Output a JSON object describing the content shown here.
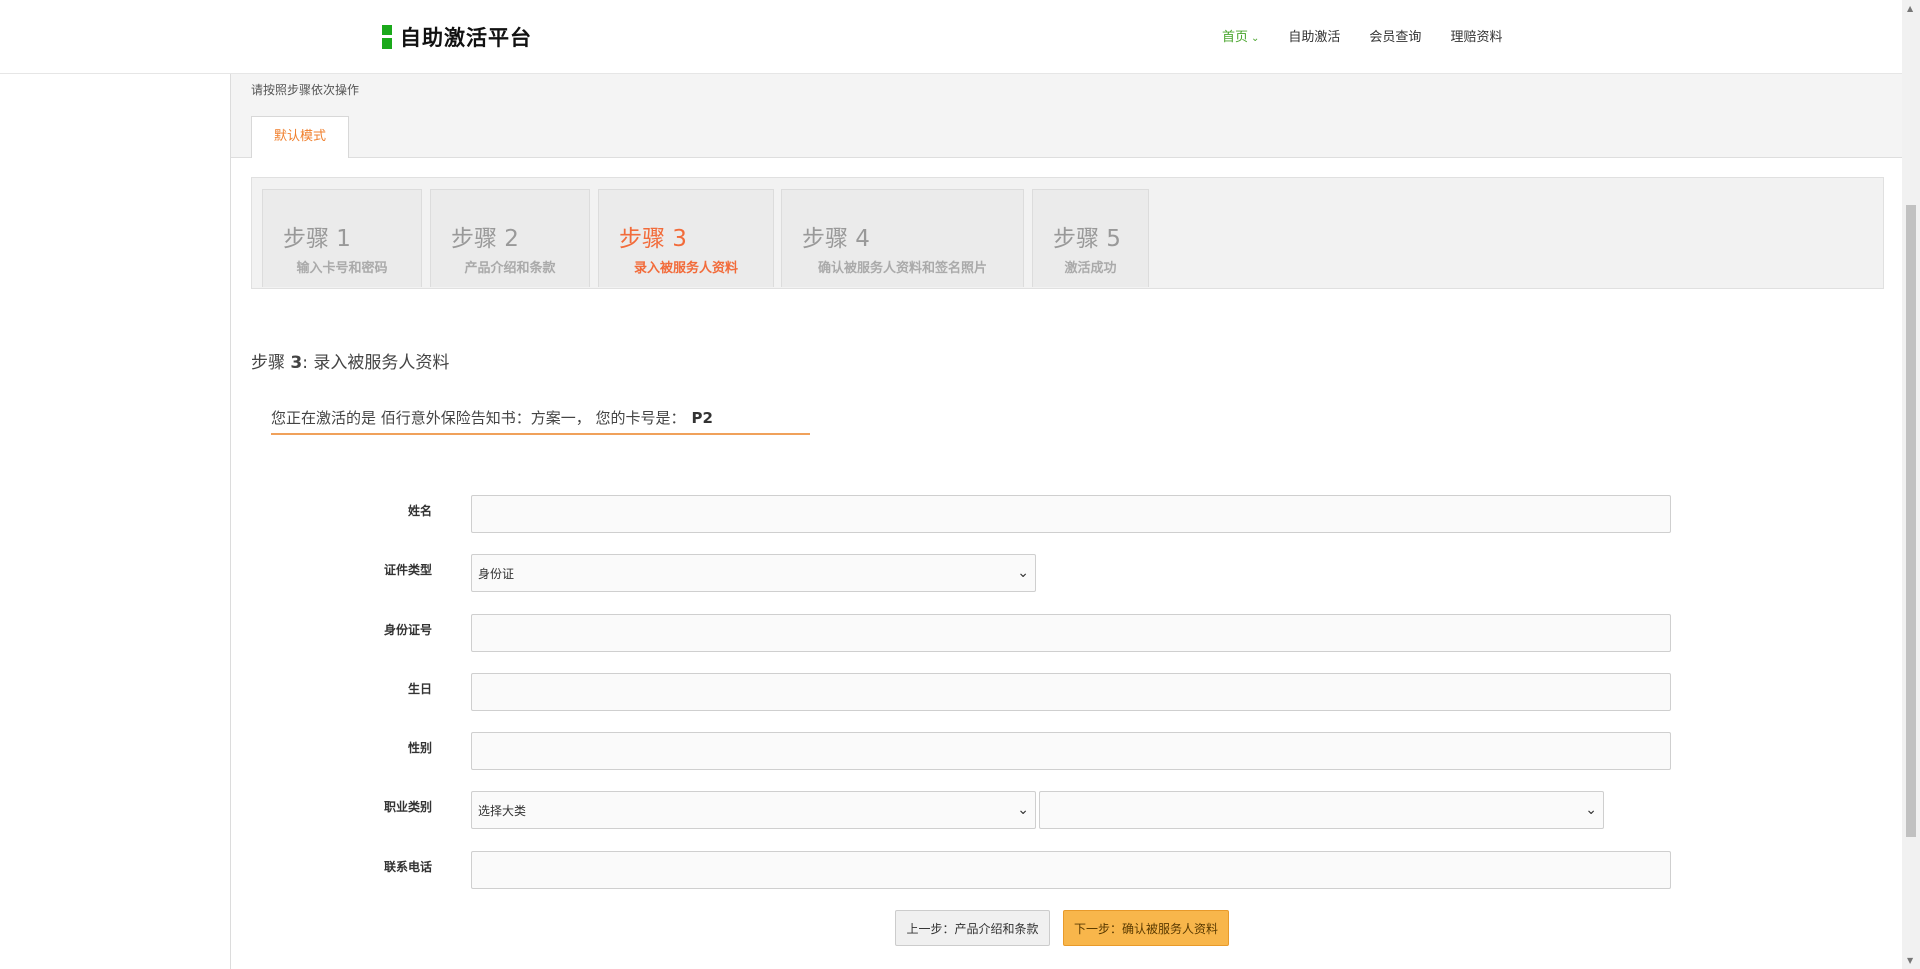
{
  "header": {
    "logo_text": "自助激活平台",
    "nav": [
      {
        "label": "首页",
        "active": true
      },
      {
        "label": "自助激活",
        "active": false
      },
      {
        "label": "会员查询",
        "active": false
      },
      {
        "label": "理赔资料",
        "active": false
      }
    ]
  },
  "hint": "请按照步骤依次操作",
  "mode_tab": "默认模式",
  "steps": [
    {
      "num": "步骤 1",
      "desc": "输入卡号和密码"
    },
    {
      "num": "步骤 2",
      "desc": "产品介绍和条款"
    },
    {
      "num": "步骤 3",
      "desc": "录入被服务人资料"
    },
    {
      "num": "步骤 4",
      "desc": "确认被服务人资料和签名照片"
    },
    {
      "num": "步骤 5",
      "desc": "激活成功"
    }
  ],
  "current_step": 3,
  "section_title": {
    "prefix": "步骤 ",
    "num": "3",
    "text": ": 录入被服务人资料"
  },
  "notice": {
    "text": "您正在激活的是 佰行意外保险告知书：方案一， 您的卡号是：",
    "card_no": "P2"
  },
  "form": {
    "name_label": "姓名",
    "name_value": "",
    "id_type_label": "证件类型",
    "id_type_value": "身份证",
    "id_no_label": "身份证号",
    "id_no_value": "",
    "birthday_label": "生日",
    "birthday_value": "",
    "gender_label": "性别",
    "gender_value": "",
    "job_label": "职业类别",
    "job_major_value": "选择大类",
    "job_minor_value": "",
    "phone_label": "联系电话",
    "phone_value": ""
  },
  "buttons": {
    "prev": "上一步：产品介绍和条款",
    "next": "下一步：确认被服务人资料"
  },
  "colors": {
    "accent_orange": "#f26b3a",
    "nav_active_green": "#4aa52e",
    "next_button": "#f8b64b",
    "logo_green": "#1aa91a"
  }
}
